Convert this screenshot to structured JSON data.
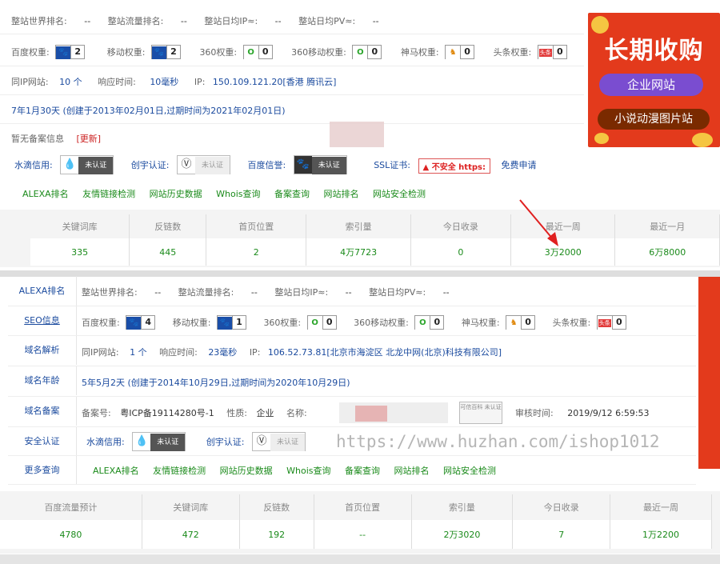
{
  "top": {
    "rank_row": [
      {
        "label": "整站世界排名:",
        "value": "--"
      },
      {
        "label": "整站流量排名:",
        "value": "--"
      },
      {
        "label": "整站日均IP≈:",
        "value": "--"
      },
      {
        "label": "整站日均PV≈:",
        "value": "--"
      }
    ],
    "weights": [
      {
        "label": "百度权重:",
        "icon": "baidu-paw-icon",
        "value": "2"
      },
      {
        "label": "移动权重:",
        "icon": "baidu-paw-icon",
        "value": "2"
      },
      {
        "label": "360权重:",
        "icon": "360-icon",
        "value": "0"
      },
      {
        "label": "360移动权重:",
        "icon": "360-icon",
        "value": "0"
      },
      {
        "label": "神马权重:",
        "icon": "shenma-icon",
        "value": "0"
      },
      {
        "label": "头条权重:",
        "icon": "toutiao-icon",
        "value": "0"
      }
    ],
    "ip_row": {
      "same_ip_label": "同IP网站:",
      "same_ip_value": "10 个",
      "resp_label": "响应时间:",
      "resp_value": "10毫秒",
      "ip_label": "IP:",
      "ip_value": "150.109.121.20[香港 腾讯云]"
    },
    "age_text": "7年1月30天 (创建于2013年02月01日,过期时间为2021年02月01日)",
    "beian_text": "暂无备案信息",
    "beian_update": "[更新]",
    "certs": {
      "water_label": "水滴信用:",
      "water_badge": "未认证",
      "chuangyu_label": "创宇认证:",
      "chuangyu_badge": "未认证",
      "baidu_label": "百度信誉:",
      "baidu_badge": "未认证",
      "ssl_label": "SSL证书:",
      "ssl_badge": "不安全 https:",
      "free_apply": "免费申请"
    },
    "links": [
      "ALEXA排名",
      "友情链接检测",
      "网站历史数据",
      "Whois查询",
      "备案查询",
      "网站排名",
      "网站安全检测"
    ],
    "stats_headers": [
      "关键词库",
      "反链数",
      "首页位置",
      "索引量",
      "今日收录",
      "最近一周",
      "最近一月"
    ],
    "stats_values": [
      "335",
      "445",
      "2",
      "4万7723",
      "0",
      "3万2000",
      "6万8000"
    ]
  },
  "ad": {
    "title": "长期收购",
    "btn1": "企业网站",
    "btn2": "小说动漫图片站"
  },
  "bottom": {
    "labels": [
      "ALEXA排名",
      "SEO信息",
      "域名解析",
      "域名年龄",
      "域名备案",
      "安全认证",
      "更多查询"
    ],
    "rank_row": [
      {
        "label": "整站世界排名:",
        "value": "--"
      },
      {
        "label": "整站流量排名:",
        "value": "--"
      },
      {
        "label": "整站日均IP≈:",
        "value": "--"
      },
      {
        "label": "整站日均PV≈:",
        "value": "--"
      }
    ],
    "weights": [
      {
        "label": "百度权重:",
        "icon": "baidu-paw-icon",
        "value": "4"
      },
      {
        "label": "移动权重:",
        "icon": "baidu-paw-icon",
        "value": "1"
      },
      {
        "label": "360权重:",
        "icon": "360-icon",
        "value": "0"
      },
      {
        "label": "360移动权重:",
        "icon": "360-icon",
        "value": "0"
      },
      {
        "label": "神马权重:",
        "icon": "shenma-icon",
        "value": "0"
      },
      {
        "label": "头条权重:",
        "icon": "toutiao-icon",
        "value": "0"
      }
    ],
    "ip_row": {
      "same_ip_label": "同IP网站:",
      "same_ip_value": "1 个",
      "resp_label": "响应时间:",
      "resp_value": "23毫秒",
      "ip_label": "IP:",
      "ip_value": "106.52.73.81[北京市海淀区 北龙中网(北京)科技有限公司]"
    },
    "age_text": "5年5月2天 (创建于2014年10月29日,过期时间为2020年10月29日)",
    "beian": {
      "num_label": "备案号:",
      "num_value": "粤ICP备19114280号-1",
      "type_label": "性质:",
      "type_value": "企业",
      "name_label": "名称:",
      "kexin_badge": "可信百科 未认证",
      "audit_label": "审核时间:",
      "audit_value": "2019/9/12 6:59:53"
    },
    "certs": {
      "water_label": "水滴信用:",
      "water_badge": "未认证",
      "chuangyu_label": "创宇认证:",
      "chuangyu_badge": "未认证"
    },
    "links": [
      "ALEXA排名",
      "友情链接检测",
      "网站历史数据",
      "Whois查询",
      "备案查询",
      "网站排名",
      "网站安全检测"
    ],
    "stats_headers": [
      "百度流量预计",
      "关键词库",
      "反链数",
      "首页位置",
      "索引量",
      "今日收录",
      "最近一周"
    ],
    "stats_values": [
      "4780",
      "472",
      "192",
      "--",
      "2万3020",
      "7",
      "1万2200"
    ]
  },
  "watermark": "https://www.huzhan.com/ishop1012"
}
